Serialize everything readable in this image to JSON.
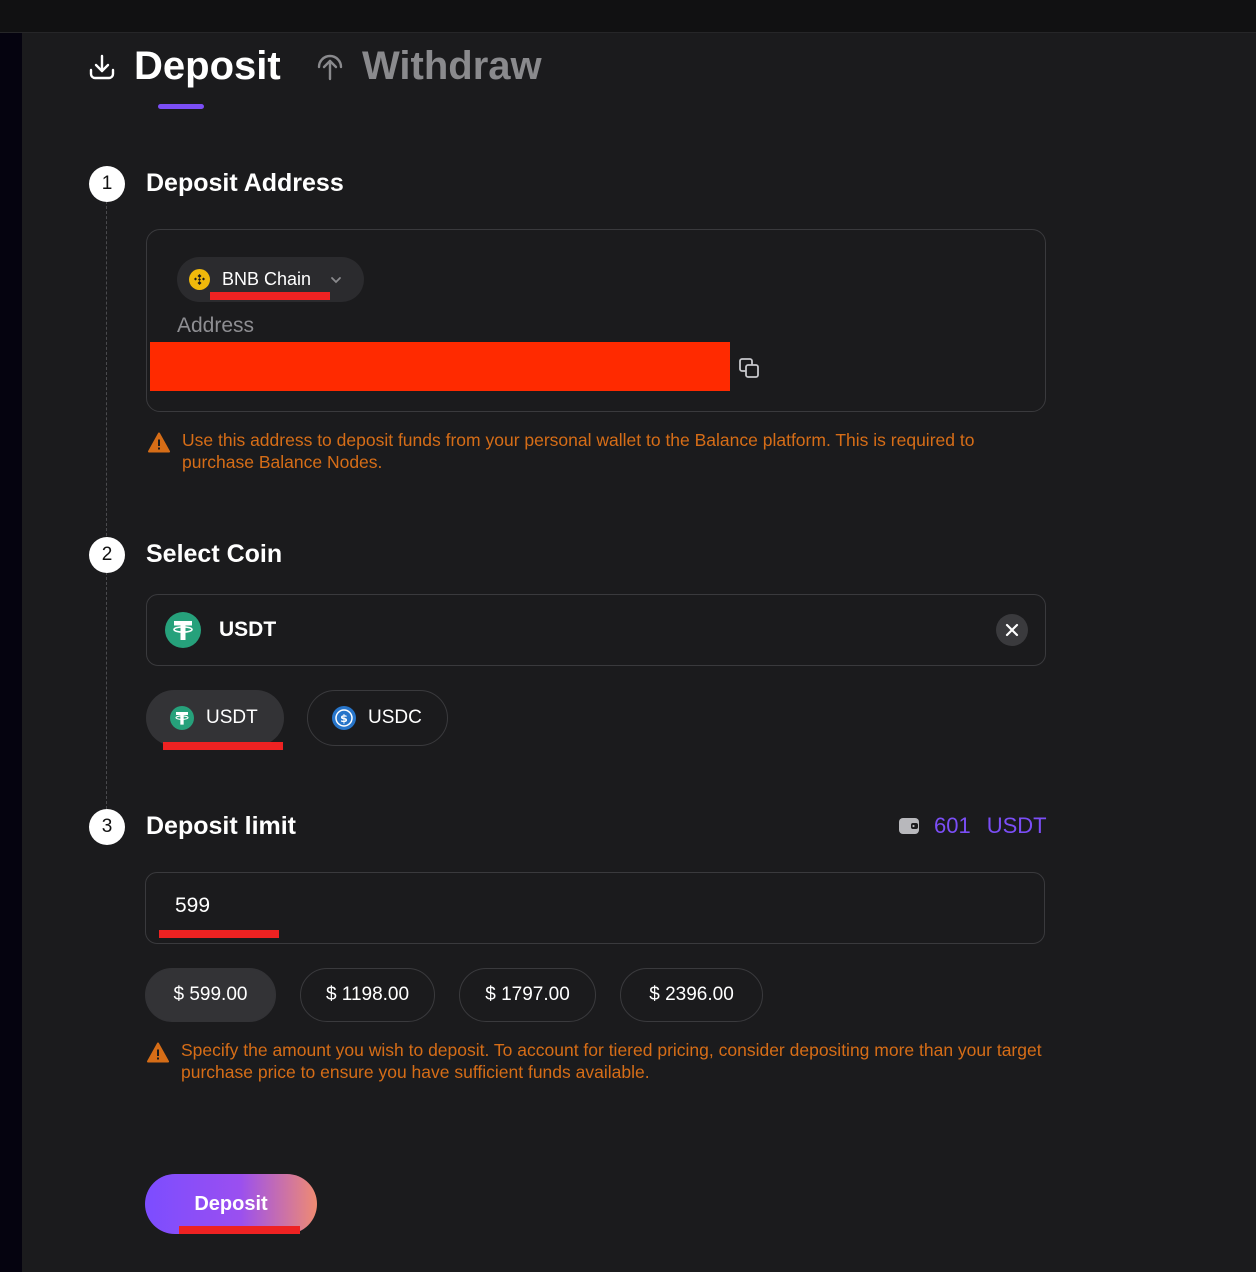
{
  "tabs": {
    "deposit_label": "Deposit",
    "withdraw_label": "Withdraw",
    "active": "deposit"
  },
  "steps": [
    {
      "number": "1",
      "title": "Deposit Address"
    },
    {
      "number": "2",
      "title": "Select Coin"
    },
    {
      "number": "3",
      "title": "Deposit limit"
    }
  ],
  "address": {
    "chain": "BNB Chain",
    "label": "Address",
    "value": "",
    "notice": "Use this address to deposit funds from your personal wallet to the Balance platform. This is required to purchase Balance Nodes."
  },
  "coin": {
    "selected": "USDT",
    "options": [
      "USDT",
      "USDC"
    ]
  },
  "limit": {
    "balance_value": "601",
    "balance_currency": "USDT",
    "amount": "599",
    "presets": [
      "$ 599.00",
      "$ 1198.00",
      "$ 1797.00",
      "$ 2396.00"
    ],
    "notice": "Specify the amount you wish to deposit. To account for tiered pricing, consider depositing more than your target purchase price to ensure you have sufficient funds available."
  },
  "submit_label": "Deposit",
  "colors": {
    "accent": "#7b4ef6",
    "warning": "#d66d17",
    "redaction": "#ff2a00",
    "tether": "#26a17b",
    "usdc": "#2775ca",
    "bnb": "#f0b90b"
  }
}
